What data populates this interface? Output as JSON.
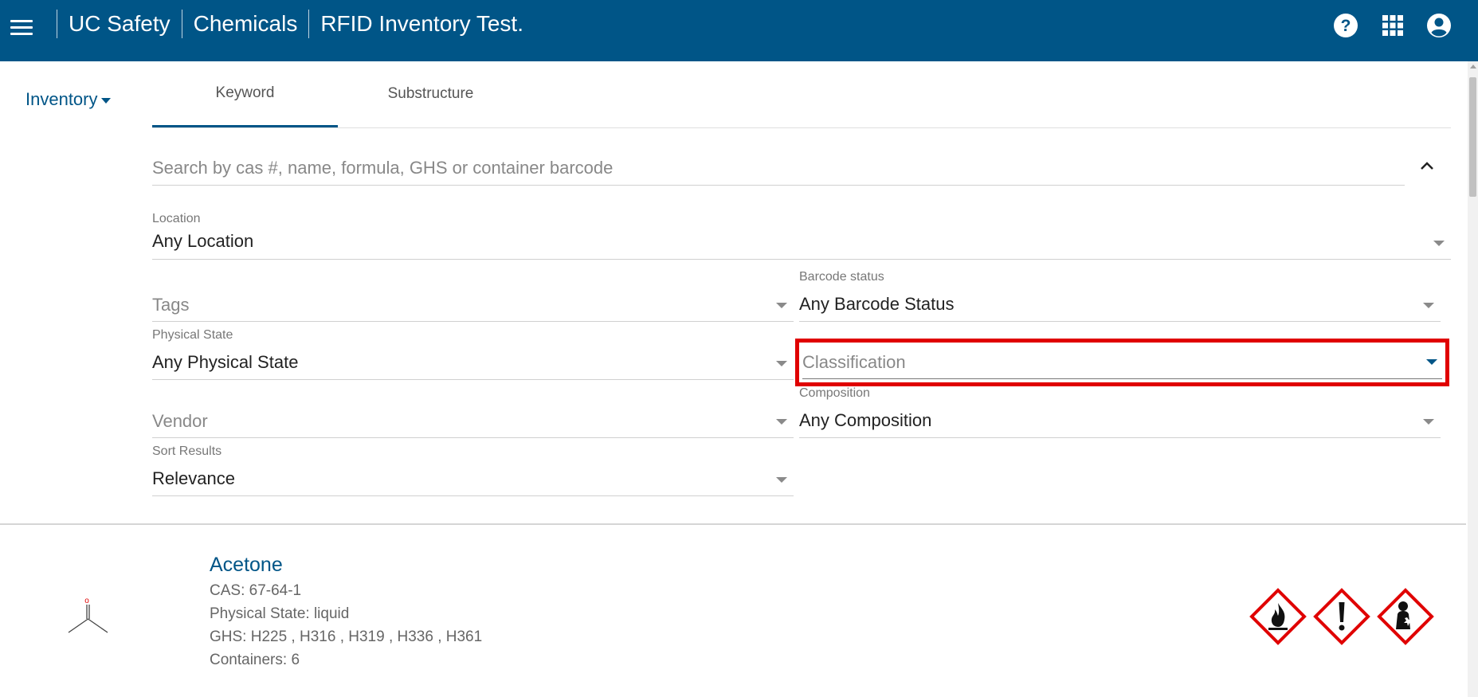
{
  "header": {
    "breadcrumbs": [
      "UC Safety",
      "Chemicals",
      "RFID Inventory Test."
    ],
    "icons": [
      "menu-icon",
      "help-icon",
      "apps-grid-icon",
      "account-icon"
    ],
    "bg_color": "#005587"
  },
  "nav": {
    "inventory_label": "Inventory"
  },
  "tabs": [
    {
      "label": "Keyword",
      "active": true
    },
    {
      "label": "Substructure",
      "active": false
    }
  ],
  "search": {
    "placeholder": "Search by cas #, name, formula, GHS or container barcode",
    "value": ""
  },
  "filters": {
    "location": {
      "label": "Location",
      "value": "Any Location"
    },
    "tags": {
      "label": "",
      "placeholder": "Tags"
    },
    "barcode_status": {
      "label": "Barcode status",
      "value": "Any Barcode Status"
    },
    "physical_state": {
      "label": "Physical State",
      "value": "Any Physical State"
    },
    "classification": {
      "label": "",
      "placeholder": "Classification"
    },
    "vendor": {
      "label": "",
      "placeholder": "Vendor"
    },
    "composition": {
      "label": "Composition",
      "value": "Any Composition"
    },
    "sort_results": {
      "label": "Sort Results",
      "value": "Relevance"
    }
  },
  "results": [
    {
      "name": "Acetone",
      "cas": "CAS: 67-64-1",
      "physical_state": "Physical State: liquid",
      "ghs": "GHS: H225 , H316 , H319 , H336 , H361",
      "containers": "Containers: 6",
      "pictograms": [
        "flame-pictogram-icon",
        "exclamation-pictogram-icon",
        "health-hazard-pictogram-icon"
      ]
    }
  ],
  "colors": {
    "accent": "#005587",
    "highlight": "#e00000",
    "ghs_red": "#e00000"
  }
}
